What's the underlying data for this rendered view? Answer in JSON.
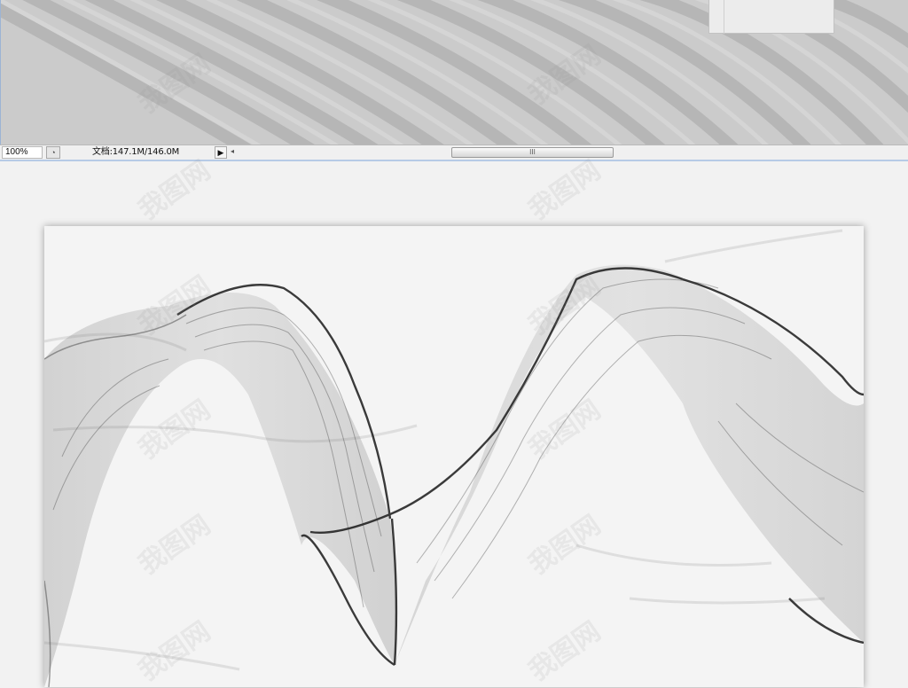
{
  "statusbar": {
    "zoom": "100%",
    "doc_info": "文档:147.1M/146.0M",
    "arrow_icon": "play-right-icon",
    "scroll_grip": "III"
  },
  "watermark": {
    "text": "我图网"
  },
  "colors": {
    "canvas_top": "#c9c9c9",
    "workspace": "#f2f2f2",
    "artwork_bg": "#f4f4f4",
    "ribbon": "#1a1a1a",
    "accent_line": "#b7cbe6"
  }
}
